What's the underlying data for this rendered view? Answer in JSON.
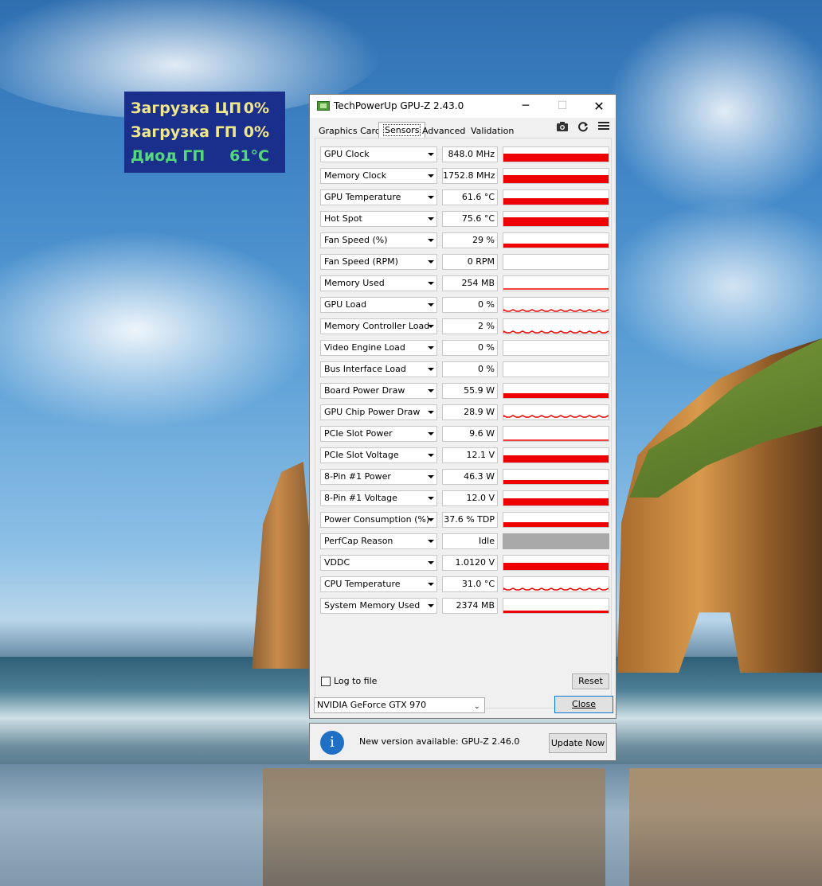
{
  "osd": {
    "rows": [
      {
        "label": "Загрузка ЦП",
        "value": "0%",
        "color": "#f0e68c"
      },
      {
        "label": "Загрузка ГП",
        "value": "0%",
        "color": "#f0e68c"
      },
      {
        "label": "Диод ГП",
        "value": "61°C",
        "color": "#53d979"
      }
    ]
  },
  "window": {
    "title": "TechPowerUp GPU-Z 2.43.0",
    "controls": {
      "minimize": "─",
      "maximize": "☐",
      "close": "✕"
    },
    "tabs": [
      "Graphics Card",
      "Sensors",
      "Advanced",
      "Validation"
    ],
    "active_tab": "Sensors",
    "tools": {
      "camera": "camera-icon",
      "refresh": "refresh-icon",
      "menu": "menu-icon"
    },
    "sensors": [
      {
        "name": "GPU Clock",
        "value": "848.0 MHz",
        "level": 0.55,
        "kind": "fill"
      },
      {
        "name": "Memory Clock",
        "value": "1752.8 MHz",
        "level": 0.55,
        "kind": "fill"
      },
      {
        "name": "GPU Temperature",
        "value": "61.6 °C",
        "level": 0.45,
        "kind": "fill"
      },
      {
        "name": "Hot Spot",
        "value": "75.6 °C",
        "level": 0.6,
        "kind": "fill"
      },
      {
        "name": "Fan Speed (%)",
        "value": "29 %",
        "level": 0.25,
        "kind": "fill"
      },
      {
        "name": "Fan Speed (RPM)",
        "value": "0 RPM",
        "level": 0,
        "kind": "empty"
      },
      {
        "name": "Memory Used",
        "value": "254 MB",
        "level": 0.12,
        "kind": "line"
      },
      {
        "name": "GPU Load",
        "value": "0 %",
        "level": 0.05,
        "kind": "spark"
      },
      {
        "name": "Memory Controller Load",
        "value": "2 %",
        "level": 0.05,
        "kind": "spark"
      },
      {
        "name": "Video Engine Load",
        "value": "0 %",
        "level": 0,
        "kind": "empty"
      },
      {
        "name": "Bus Interface Load",
        "value": "0 %",
        "level": 0,
        "kind": "empty"
      },
      {
        "name": "Board Power Draw",
        "value": "55.9 W",
        "level": 0.35,
        "kind": "fill"
      },
      {
        "name": "GPU Chip Power Draw",
        "value": "28.9 W",
        "level": 0.15,
        "kind": "spark"
      },
      {
        "name": "PCIe Slot Power",
        "value": "9.6 W",
        "level": 0.08,
        "kind": "line"
      },
      {
        "name": "PCIe Slot Voltage",
        "value": "12.1 V",
        "level": 0.5,
        "kind": "fill"
      },
      {
        "name": "8-Pin #1 Power",
        "value": "46.3 W",
        "level": 0.3,
        "kind": "fill"
      },
      {
        "name": "8-Pin #1 Voltage",
        "value": "12.0 V",
        "level": 0.5,
        "kind": "fill"
      },
      {
        "name": "Power Consumption (%)",
        "value": "37.6 % TDP",
        "level": 0.35,
        "kind": "fill"
      },
      {
        "name": "PerfCap Reason",
        "value": "Idle",
        "level": 1,
        "kind": "idle"
      },
      {
        "name": "VDDC",
        "value": "1.0120 V",
        "level": 0.5,
        "kind": "fill"
      },
      {
        "name": "CPU Temperature",
        "value": "31.0 °C",
        "level": 0.1,
        "kind": "spark"
      },
      {
        "name": "System Memory Used",
        "value": "2374 MB",
        "level": 0.15,
        "kind": "fill"
      }
    ],
    "log_label": "Log to file",
    "log_checked": false,
    "reset_label": "Reset",
    "gpu_select_value": "NVIDIA GeForce GTX 970",
    "close_label": "Close",
    "accent_red": "#ee0000"
  },
  "update": {
    "icon": "info-icon",
    "icon_glyph": "i",
    "message": "New version available: GPU-Z 2.46.0",
    "button_label": "Update Now"
  }
}
